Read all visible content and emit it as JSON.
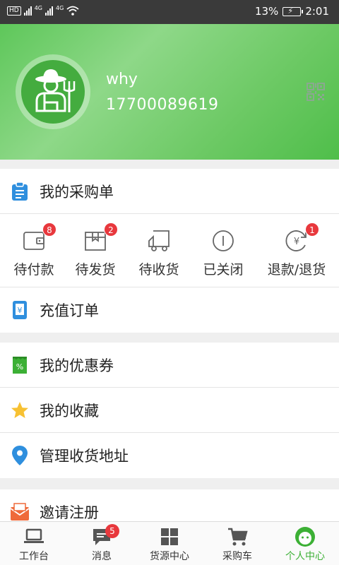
{
  "status_bar": {
    "hd_label": "HD",
    "net1_label": "4G",
    "net2_label": "4G",
    "battery": "13%",
    "time": "2:01"
  },
  "profile": {
    "username": "why",
    "phone": "17700089619"
  },
  "colors": {
    "accent": "#3cb035",
    "badge": "#e8383d",
    "header": "#6cc964"
  },
  "purchase": {
    "title": "我的采购单",
    "orders": [
      {
        "label": "待付款",
        "badge": "8",
        "icon": "wallet-icon"
      },
      {
        "label": "待发货",
        "badge": "2",
        "icon": "package-icon"
      },
      {
        "label": "待收货",
        "badge": "",
        "icon": "truck-icon"
      },
      {
        "label": "已关闭",
        "badge": "",
        "icon": "closed-circle-icon"
      },
      {
        "label": "退款/退货",
        "badge": "1",
        "icon": "refund-icon"
      }
    ]
  },
  "recharge": {
    "title": "充值订单"
  },
  "menu": {
    "coupons": "我的优惠券",
    "favorites": "我的收藏",
    "address": "管理收货地址",
    "invite": "邀请注册"
  },
  "nav": [
    {
      "label": "工作台",
      "icon": "laptop-icon"
    },
    {
      "label": "消息",
      "icon": "message-icon",
      "badge": "5"
    },
    {
      "label": "货源中心",
      "icon": "grid-icon"
    },
    {
      "label": "采购车",
      "icon": "cart-icon"
    },
    {
      "label": "个人中心",
      "icon": "profile-face-icon",
      "active": true
    }
  ]
}
